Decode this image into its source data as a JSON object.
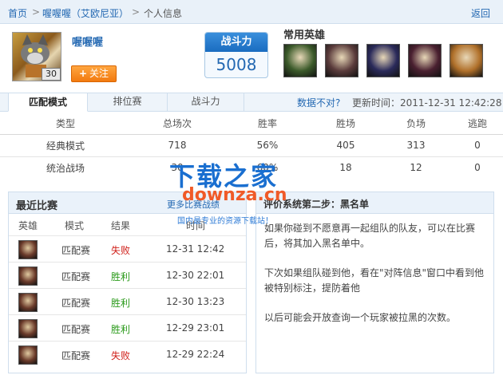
{
  "breadcrumb": {
    "home": "首页",
    "sep1": ">",
    "server": "喔喔喔（艾欧尼亚）",
    "sep2": ">",
    "current": "个人信息",
    "back": "返回"
  },
  "player": {
    "name": "喔喔喔",
    "level": "30",
    "follow_plus": "+",
    "follow_label": "关注"
  },
  "power": {
    "title": "战斗力",
    "value": "5008"
  },
  "heroes": {
    "title": "常用英雄",
    "items": [
      {
        "icon": "hero-bug-icon",
        "color": "#3b5a2a"
      },
      {
        "icon": "hero-akali-icon",
        "color": "#5a3b3b"
      },
      {
        "icon": "hero-kassadin-icon",
        "color": "#2a2a5a"
      },
      {
        "icon": "hero-vayne-icon",
        "color": "#4a2030"
      },
      {
        "icon": "hero-jax-icon",
        "color": "#b0702a"
      }
    ]
  },
  "tabs": {
    "items": [
      {
        "label": "匹配模式"
      },
      {
        "label": "排位赛"
      },
      {
        "label": "战斗力"
      }
    ],
    "data_wrong": "数据不对?",
    "update_time": "更新时间：2011-12-31 12:42:28"
  },
  "stats": {
    "headers": [
      "类型",
      "总场次",
      "胜率",
      "胜场",
      "负场",
      "逃跑"
    ],
    "rows": [
      [
        "经典模式",
        "718",
        "56%",
        "405",
        "313",
        "0"
      ],
      [
        "统治战场",
        "30",
        "60%",
        "18",
        "12",
        "0"
      ]
    ]
  },
  "watermark": {
    "main": "下载之家",
    "url": "downza.cn",
    "sub": "国内最专业的资源下载站！"
  },
  "recent": {
    "title": "最近比赛",
    "more": "更多比赛战绩",
    "headers": [
      "英雄",
      "模式",
      "结果",
      "时间"
    ],
    "rows": [
      {
        "icon": "hero-akali-icon",
        "mode": "匹配赛",
        "result": "失败",
        "time": "12-31 12:42",
        "result_color": "#d0201a"
      },
      {
        "icon": "hero-akali-icon",
        "mode": "匹配赛",
        "result": "胜利",
        "time": "12-30 22:01",
        "result_color": "#2a9a1a"
      },
      {
        "icon": "hero-akali-icon",
        "mode": "匹配赛",
        "result": "胜利",
        "time": "12-30 13:23",
        "result_color": "#2a9a1a"
      },
      {
        "icon": "hero-akali-icon",
        "mode": "匹配赛",
        "result": "胜利",
        "time": "12-29 23:01",
        "result_color": "#2a9a1a"
      },
      {
        "icon": "hero-bug-icon",
        "mode": "匹配赛",
        "result": "失败",
        "time": "12-29 22:24",
        "result_color": "#d0201a"
      }
    ]
  },
  "tip": {
    "title": "评价系统第二步：黑名单",
    "p1": "如果你碰到不愿意再一起组队的队友，可以在比赛后，将其加入黑名单中。",
    "p2": "下次如果组队碰到他，看在\"对阵信息\"窗口中看到他被特别标注，提防着他",
    "p3": "以后可能会开放查询一个玩家被拉黑的次数。"
  }
}
